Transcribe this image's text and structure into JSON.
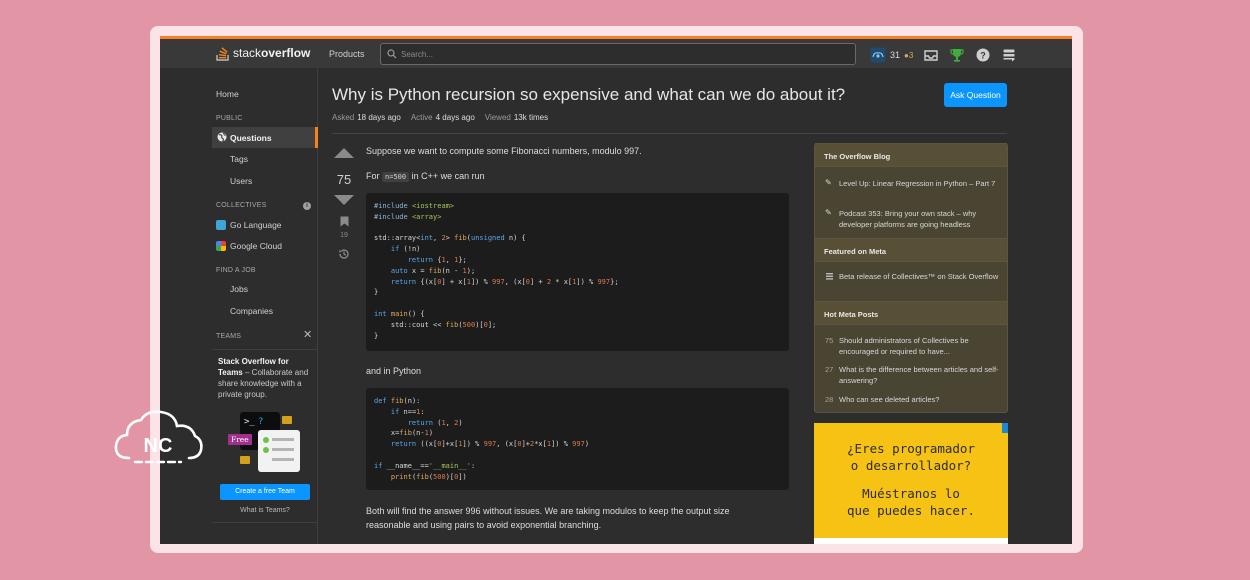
{
  "topbar": {
    "logo_light": "stack",
    "logo_bold": "overflow",
    "products": "Products",
    "search_placeholder": "Search...",
    "reputation": "31",
    "bronze_badges": "●3"
  },
  "sidebar": {
    "home": "Home",
    "public_heading": "PUBLIC",
    "questions": "Questions",
    "tags": "Tags",
    "users": "Users",
    "collectives_heading": "COLLECTIVES",
    "go_language": "Go Language",
    "google_cloud": "Google Cloud",
    "find_job_heading": "FIND A JOB",
    "jobs": "Jobs",
    "companies": "Companies",
    "teams_heading": "TEAMS",
    "teams_title": "Stack Overflow for Teams",
    "teams_desc": " – Collaborate and share knowledge with a private group.",
    "free_tag": "Free",
    "create_team": "Create a free Team",
    "what_is_teams": "What is Teams?"
  },
  "question": {
    "title": "Why is Python recursion so expensive and what can we do about it?",
    "ask_button": "Ask Question",
    "asked_label": "Asked",
    "asked_value": "18 days ago",
    "active_label": "Active",
    "active_value": "4 days ago",
    "viewed_label": "Viewed",
    "viewed_value": "13k times",
    "votes": "75",
    "bookmarks": "19",
    "p1": "Suppose we want to compute some Fibonacci numbers, modulo 997.",
    "p2_pre": "For",
    "p2_code": "n=500",
    "p2_post": "in C++ we can run",
    "p3": "and in Python",
    "p4_line1": "Both will find the answer 996 without issues. We are taking modulos to keep the output size",
    "p4_line2": "reasonable and using pairs to avoid exponential branching."
  },
  "cpp_code": [
    "#include <iostream>",
    "#include <array>",
    "",
    "std::array<int, 2> fib(unsigned n) {",
    "    if (!n)",
    "        return {1, 1};",
    "    auto x = fib(n - 1);",
    "    return {(x[0] + x[1]) % 997, (x[0] + 2 * x[1]) % 997};",
    "}",
    "",
    "int main() {",
    "    std::cout << fib(500)[0];",
    "}"
  ],
  "py_code": [
    "def fib(n):",
    "    if n==1:",
    "        return (1, 2)",
    "    x=fib(n-1)",
    "    return ((x[0]+x[1]) % 997, (x[0]+2*x[1]) % 997)",
    "",
    "if __name__=='__main__':",
    "    print(fib(500)[0])"
  ],
  "right": {
    "blog_heading": "The Overflow Blog",
    "blog_item1": "Level Up: Linear Regression in Python – Part 7",
    "blog_item2": "Podcast 353: Bring your own stack – why developer platforms are going headless",
    "meta_heading": "Featured on Meta",
    "meta_item1": "Beta release of Collectives™ on Stack Overflow",
    "hot_heading": "Hot Meta Posts",
    "hot": [
      {
        "num": "75",
        "text": "Should administrators of Collectives be encouraged or required to have..."
      },
      {
        "num": "27",
        "text": "What is the difference between articles and self-answering?"
      },
      {
        "num": "28",
        "text": "Who can see deleted articles?"
      }
    ],
    "ad_line1": "¿Eres programador",
    "ad_line2": "o desarrollador?",
    "ad_line3": "Muéstranos lo",
    "ad_line4": "que puedes hacer."
  },
  "watermark": {
    "text": "NC"
  },
  "colors": {
    "background": "#e295a4",
    "accent": "#f48225",
    "button": "#0a95ff",
    "ad": "#f6c315"
  }
}
